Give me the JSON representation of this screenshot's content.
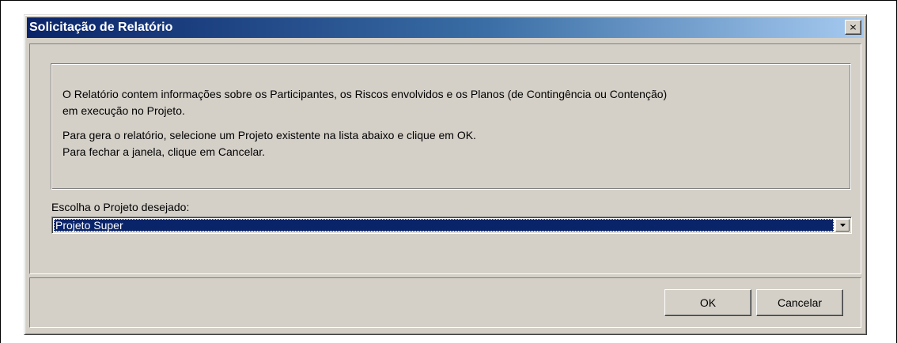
{
  "window": {
    "title": "Solicitação de Relatório",
    "close_glyph": "×",
    "close_icon": "close-icon"
  },
  "info": {
    "paragraph1": [
      "O Relatório contem informações sobre os Participantes, os Riscos envolvidos e os Planos (de Contingência ou Contenção)",
      "em execução no Projeto."
    ],
    "paragraph2": [
      "Para gera o relatório, selecione um Projeto existente na lista abaixo e clique em OK.",
      "Para fechar a janela, clique em Cancelar."
    ]
  },
  "project_select": {
    "label": "Escolha o Projeto desejado:",
    "selected_value": "Projeto Super",
    "arrow_icon": "chevron-down-icon"
  },
  "buttons": {
    "ok_label": "OK",
    "cancel_label": "Cancelar"
  },
  "colors": {
    "title_bar_start": "#0a246a",
    "title_bar_end": "#a6caf0",
    "dialog_face": "#d4d0c8",
    "selection": "#0a246a"
  }
}
